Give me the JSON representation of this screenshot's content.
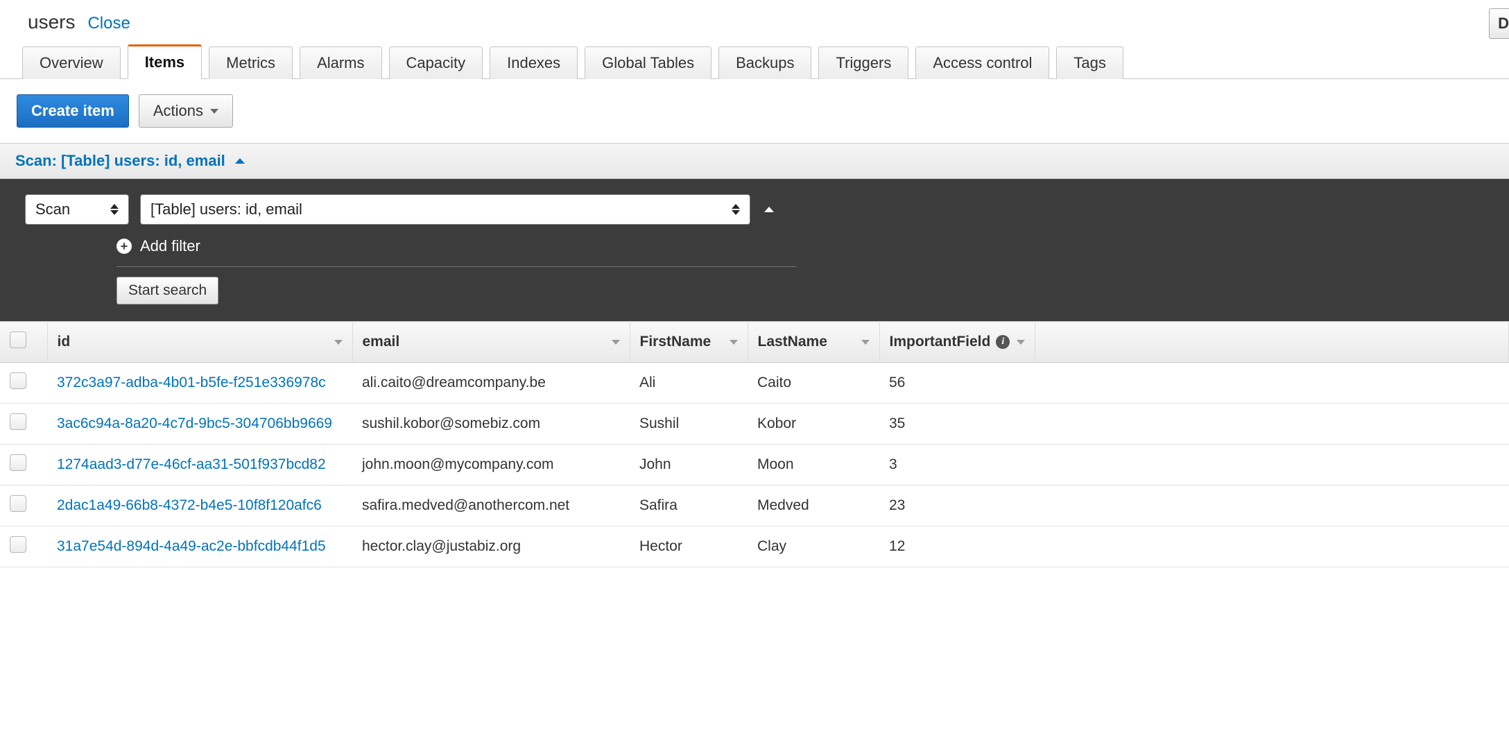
{
  "header": {
    "table_name": "users",
    "close_label": "Close",
    "right_cut_label": "D"
  },
  "tabs": [
    {
      "label": "Overview"
    },
    {
      "label": "Items",
      "active": true
    },
    {
      "label": "Metrics"
    },
    {
      "label": "Alarms"
    },
    {
      "label": "Capacity"
    },
    {
      "label": "Indexes"
    },
    {
      "label": "Global Tables"
    },
    {
      "label": "Backups"
    },
    {
      "label": "Triggers"
    },
    {
      "label": "Access control"
    },
    {
      "label": "Tags"
    }
  ],
  "toolbar": {
    "create_label": "Create item",
    "actions_label": "Actions"
  },
  "scan": {
    "header_label": "Scan: [Table] users: id, email",
    "mode_select": "Scan",
    "table_select": "[Table] users: id, email",
    "add_filter_label": "Add filter",
    "start_label": "Start search"
  },
  "columns": {
    "id": "id",
    "email": "email",
    "first": "FirstName",
    "last": "LastName",
    "imp": "ImportantField"
  },
  "rows": [
    {
      "id": "372c3a97-adba-4b01-b5fe-f251e336978c",
      "email": "ali.caito@dreamcompany.be",
      "first": "Ali",
      "last": "Caito",
      "imp": "56"
    },
    {
      "id": "3ac6c94a-8a20-4c7d-9bc5-304706bb9669",
      "email": "sushil.kobor@somebiz.com",
      "first": "Sushil",
      "last": "Kobor",
      "imp": "35"
    },
    {
      "id": "1274aad3-d77e-46cf-aa31-501f937bcd82",
      "email": "john.moon@mycompany.com",
      "first": "John",
      "last": "Moon",
      "imp": "3"
    },
    {
      "id": "2dac1a49-66b8-4372-b4e5-10f8f120afc6",
      "email": "safira.medved@anothercom.net",
      "first": "Safira",
      "last": "Medved",
      "imp": "23"
    },
    {
      "id": "31a7e54d-894d-4a49-ac2e-bbfcdb44f1d5",
      "email": "hector.clay@justabiz.org",
      "first": "Hector",
      "last": "Clay",
      "imp": "12"
    }
  ]
}
